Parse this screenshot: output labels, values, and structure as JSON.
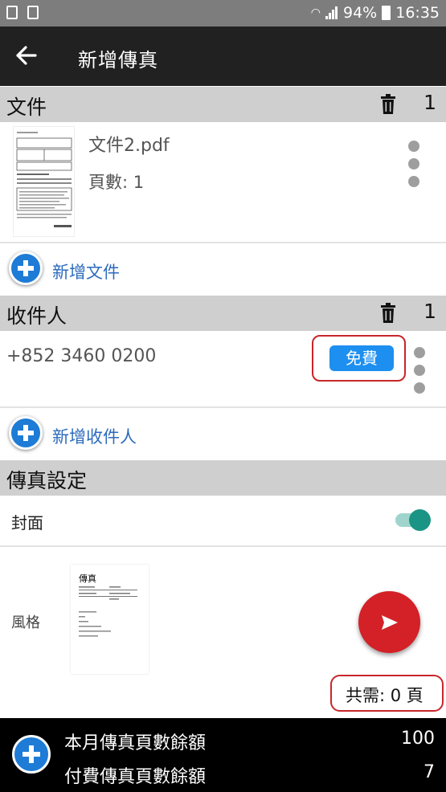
{
  "status_bar": {
    "battery": "94%",
    "time": "16:35"
  },
  "app_bar": {
    "title": "新增傳真"
  },
  "documents": {
    "header": "文件",
    "count": "1",
    "items": [
      {
        "name": "文件2.pdf",
        "pages": "頁數: 1"
      }
    ],
    "add_label": "新增文件"
  },
  "recipients": {
    "header": "收件人",
    "count": "1",
    "items": [
      {
        "number": "+852 3460 0200",
        "badge": "免費"
      }
    ],
    "add_label": "新增收件人"
  },
  "settings": {
    "header": "傳真設定",
    "cover_label": "封面",
    "cover_enabled": true,
    "style_label": "風格",
    "cover_preview_title": "傳真"
  },
  "total": "共需: 0 頁",
  "balance": {
    "monthly_label": "本月傳真頁數餘額",
    "monthly_value": "100",
    "paid_label": "付費傳真頁數餘額",
    "paid_value": "7"
  },
  "colors": {
    "accent_blue": "#1e7bd6",
    "fab_red": "#d32127",
    "toggle_teal": "#1a9484",
    "highlight_red": "#c8262a"
  }
}
